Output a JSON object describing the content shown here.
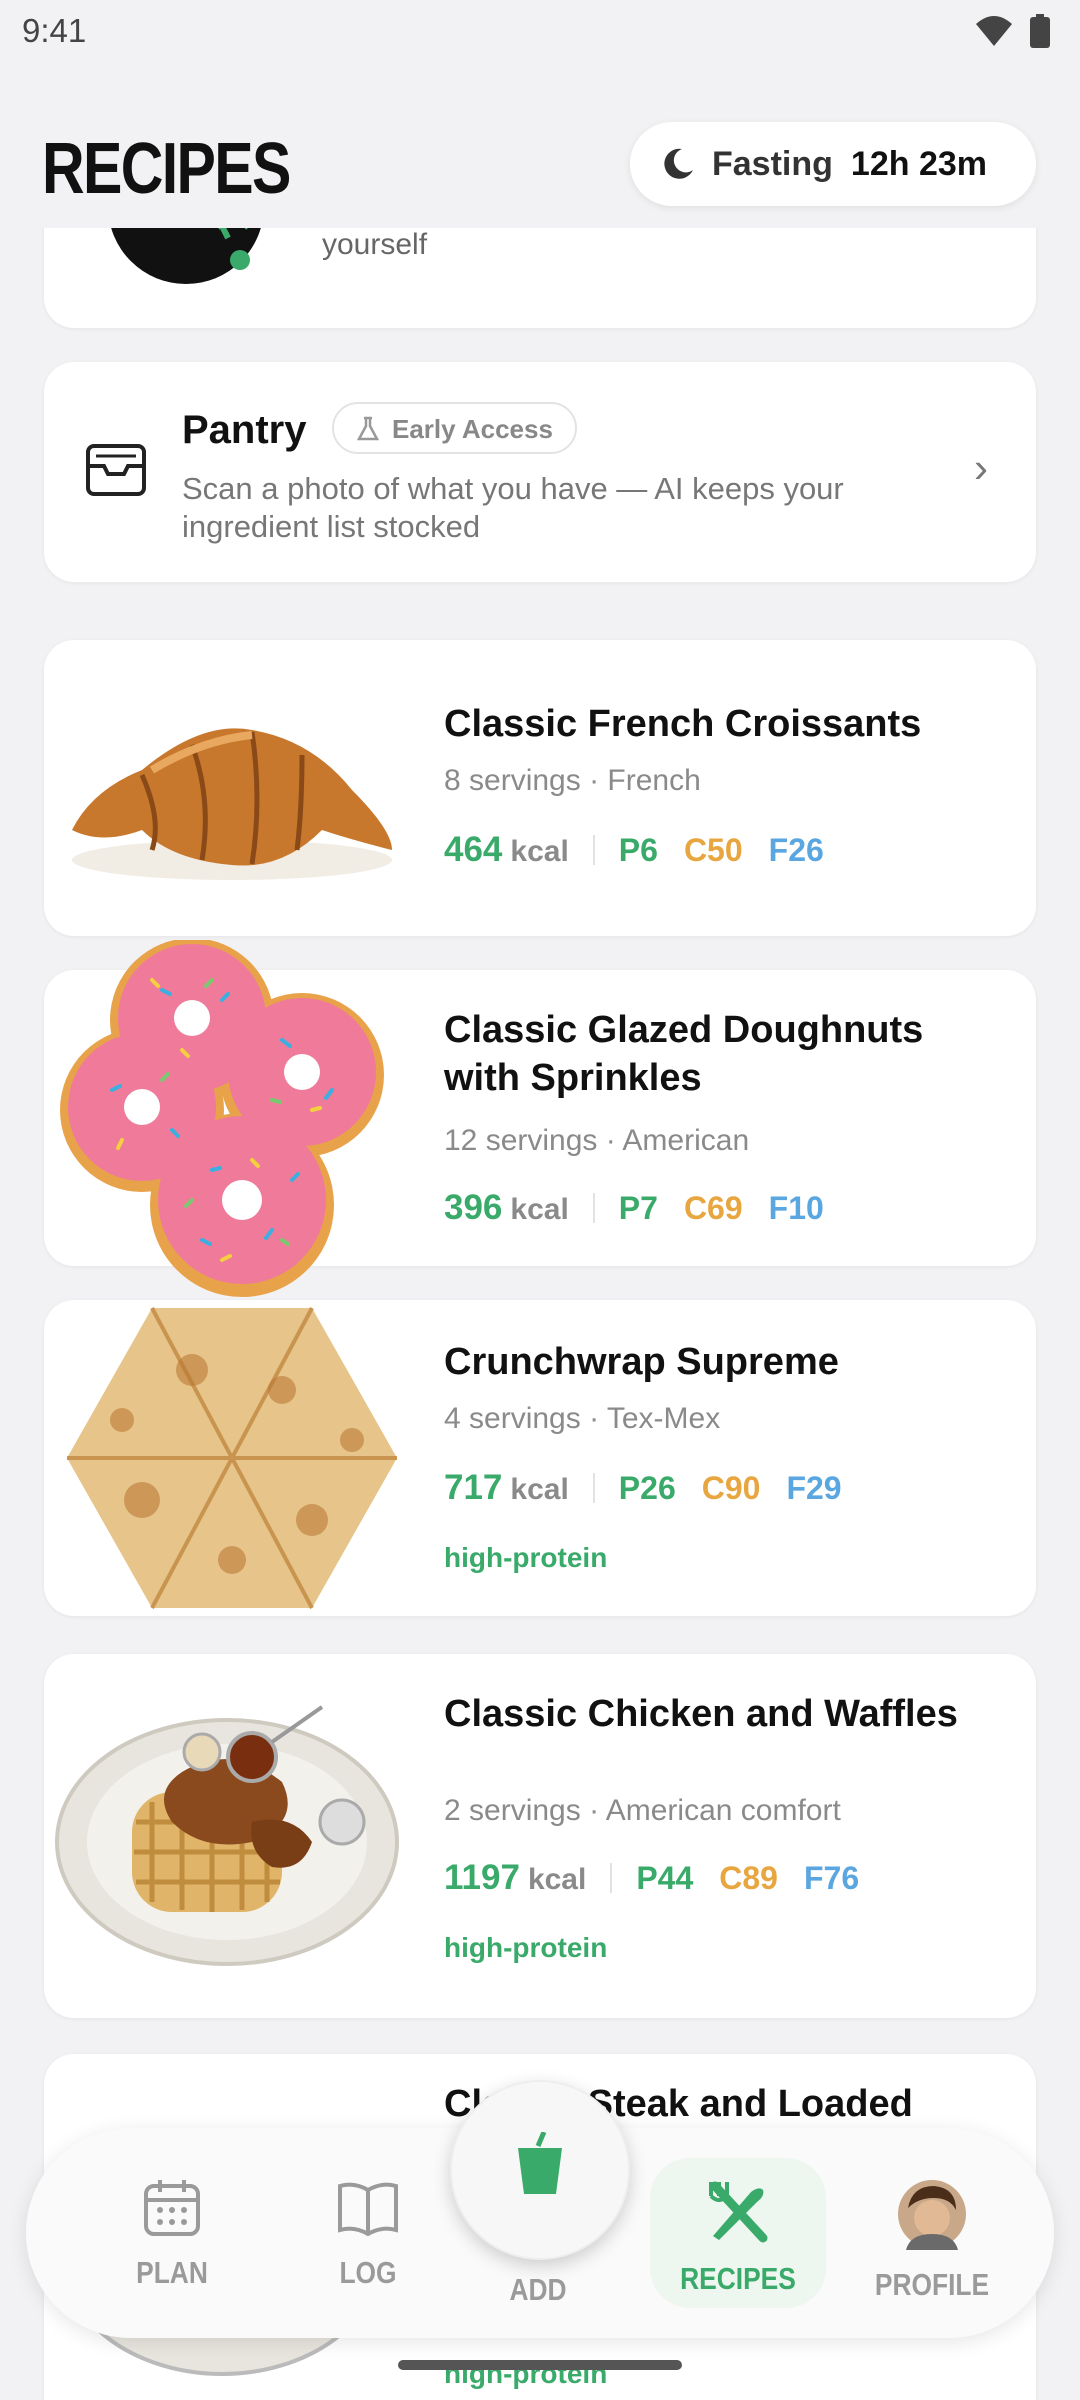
{
  "status_bar": {
    "time": "9:41"
  },
  "header": {
    "title": "RECIPES",
    "fasting_label": "Fasting",
    "fasting_time": "12h 23m"
  },
  "create_card": {
    "description": "Generate one from a description, or build it yourself"
  },
  "pantry": {
    "title": "Pantry",
    "badge": "Early Access",
    "description": "Scan a photo of what you have — AI keeps your ingredient list stocked"
  },
  "recipes": [
    {
      "title": "Classic French Croissants",
      "subtitle": "8 servings · French",
      "kcal": "464",
      "kcal_unit": "kcal",
      "protein": "P6",
      "carbs": "C50",
      "fat": "F26",
      "tag": ""
    },
    {
      "title": "Classic Glazed Doughnuts with Sprinkles",
      "subtitle": "12 servings · American",
      "kcal": "396",
      "kcal_unit": "kcal",
      "protein": "P7",
      "carbs": "C69",
      "fat": "F10",
      "tag": ""
    },
    {
      "title": "Crunchwrap Supreme",
      "subtitle": "4 servings · Tex-Mex",
      "kcal": "717",
      "kcal_unit": "kcal",
      "protein": "P26",
      "carbs": "C90",
      "fat": "F29",
      "tag": "high-protein"
    },
    {
      "title": "Classic Chicken and Waffles",
      "subtitle": "2 servings · American comfort",
      "kcal": "1197",
      "kcal_unit": "kcal",
      "protein": "P44",
      "carbs": "C89",
      "fat": "F76",
      "tag": "high-protein"
    },
    {
      "title": "Classic Steak and Loaded",
      "tag": "high-protein"
    }
  ],
  "nav": {
    "plan": "PLAN",
    "log": "LOG",
    "add": "ADD",
    "recipes": "RECIPES",
    "profile": "PROFILE"
  },
  "colors": {
    "accent_green": "#3aaa6a",
    "carbs_orange": "#e8a640",
    "fat_blue": "#5aa6e0",
    "background": "#f2f2f4"
  }
}
